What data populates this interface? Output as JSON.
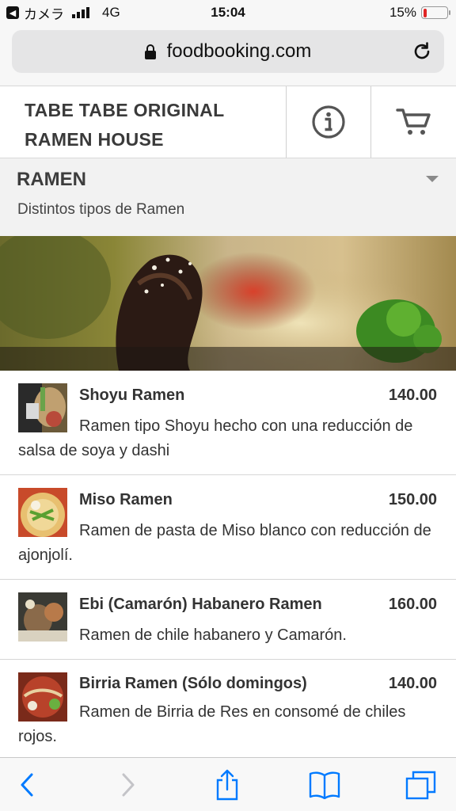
{
  "status_bar": {
    "carrier": "カメラ",
    "network": "4G",
    "time": "15:04",
    "battery_percent": "15%",
    "battery_level": 0.15
  },
  "browser": {
    "url": "foodbooking.com"
  },
  "header": {
    "shop_name_line1": "TABE TABE ORIGINAL",
    "shop_name_line2": "RAMEN HOUSE",
    "info_icon": "info-icon",
    "cart_icon": "cart-icon"
  },
  "category": {
    "title": "RAMEN",
    "description": "Distintos tipos de Ramen"
  },
  "items": [
    {
      "name": "Shoyu Ramen",
      "price": "140.00",
      "description": "Ramen tipo Shoyu hecho con una reducción de salsa de soya y dashi"
    },
    {
      "name": "Miso Ramen",
      "price": "150.00",
      "description": "Ramen de pasta de Miso blanco con reducción de ajonjolí."
    },
    {
      "name": "Ebi (Camarón) Habanero Ramen",
      "price": "160.00",
      "description": "Ramen de chile habanero y Camarón."
    },
    {
      "name": "Birria Ramen (Sólo domingos)",
      "price": "140.00",
      "description": "Ramen de Birria de Res en consomé de chiles rojos."
    }
  ],
  "colors": {
    "accent": "#007aff",
    "battery_low": "#e02424"
  }
}
